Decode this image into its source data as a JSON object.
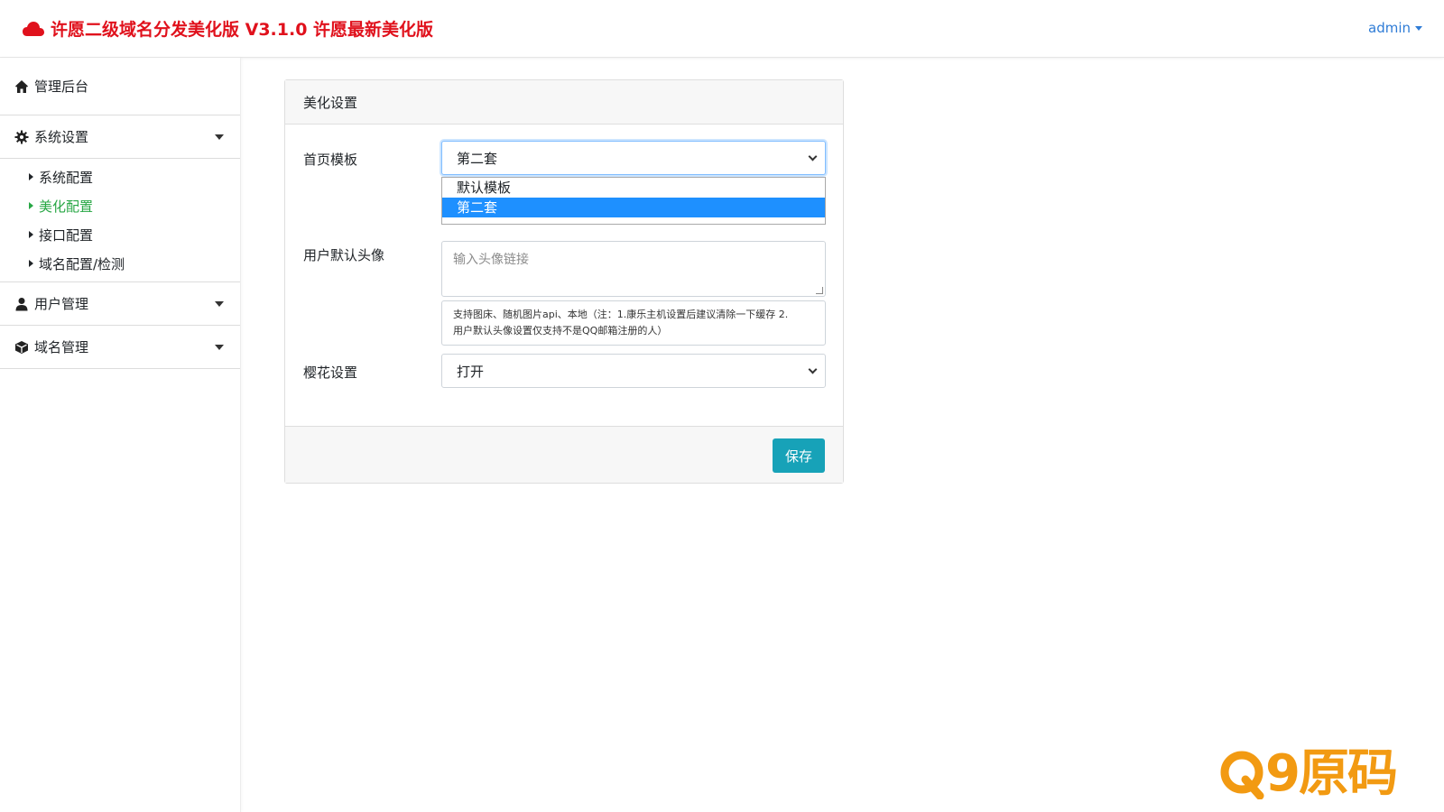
{
  "header": {
    "title": "许愿二级域名分发美化版 V3.1.0 许愿最新美化版",
    "user": "admin",
    "brand_color": "#e0111c"
  },
  "sidebar": {
    "home": "管理后台",
    "groups": [
      {
        "label": "系统设置",
        "icon": "gear-icon",
        "expanded": true,
        "items": [
          "系统配置",
          "美化配置",
          "接口配置",
          "域名配置/检测"
        ],
        "active_index": 1
      },
      {
        "label": "用户管理",
        "icon": "user-icon",
        "expanded": false
      },
      {
        "label": "域名管理",
        "icon": "cube-icon",
        "expanded": false
      }
    ]
  },
  "card": {
    "title": "美化设置",
    "template_field": {
      "label": "首页模板",
      "value": "第二套",
      "options": [
        "默认模板",
        "第二套"
      ],
      "highlighted_index": 1
    },
    "avatar_field": {
      "label": "用户默认头像",
      "placeholder": "输入头像链接",
      "help_line1": "支持图床、随机图片api、本地（注：1.康乐主机设置后建议清除一下缓存 2.",
      "help_line2": "用户默认头像设置仅支持不是QQ邮箱注册的人）"
    },
    "sakura_field": {
      "label": "樱花设置",
      "value": "打开"
    },
    "save_label": "保存"
  },
  "watermark": {
    "text": "9原码",
    "color": "#f29a12"
  }
}
